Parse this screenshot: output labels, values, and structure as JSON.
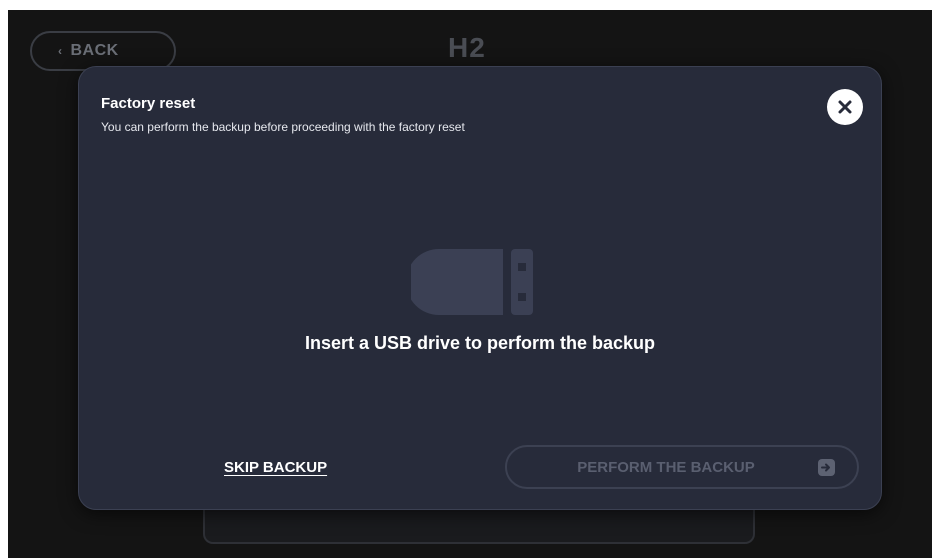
{
  "header": {
    "back_label": "BACK",
    "logo_text": "H2"
  },
  "modal": {
    "title": "Factory reset",
    "subtitle": "You can perform the backup before proceeding with the factory reset",
    "close_icon": "close-icon",
    "usb_icon": "usb-drive-icon",
    "message": "Insert a USB drive to perform the backup",
    "skip_label": "SKIP BACKUP",
    "perform_label": "PERFORM THE BACKUP",
    "perform_icon": "arrow-right-icon"
  },
  "colors": {
    "screen_bg": "#141414",
    "modal_bg": "#272b3a",
    "disabled_text": "#5a5f70",
    "text_primary": "#ffffff"
  }
}
